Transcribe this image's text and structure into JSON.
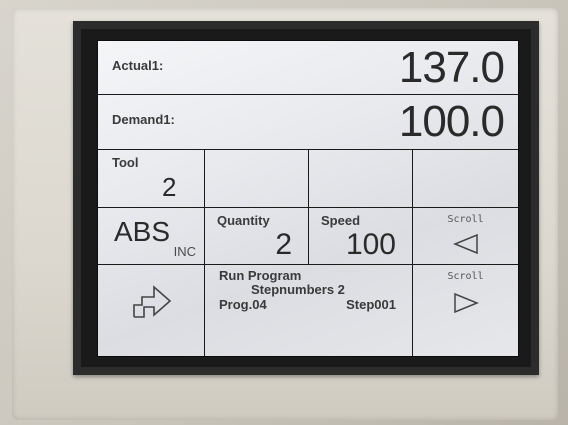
{
  "display": {
    "actual": {
      "label": "Actual1:",
      "value": "137.0"
    },
    "demand": {
      "label": "Demand1:",
      "value": "100.0"
    },
    "tool": {
      "label": "Tool",
      "value": "2"
    },
    "mode": {
      "label": "ABS",
      "sub": "INC"
    },
    "quantity": {
      "label": "Quantity",
      "value": "2"
    },
    "speed": {
      "label": "Speed",
      "value": "100"
    },
    "scroll_left": {
      "label": "Scroll",
      "icon": "triangle-left-icon"
    },
    "scroll_right": {
      "label": "Scroll",
      "icon": "triangle-right-icon"
    },
    "home": {
      "icon": "home-arrow-icon"
    },
    "program": {
      "title": "Run Program",
      "stepnumbers": "Stepnumbers  2",
      "prog": "Prog.04",
      "step": "Step001"
    }
  },
  "colors": {
    "screen": "#e9eaee",
    "text": "#2a2a2a",
    "bezel": "#2c2c2c"
  }
}
